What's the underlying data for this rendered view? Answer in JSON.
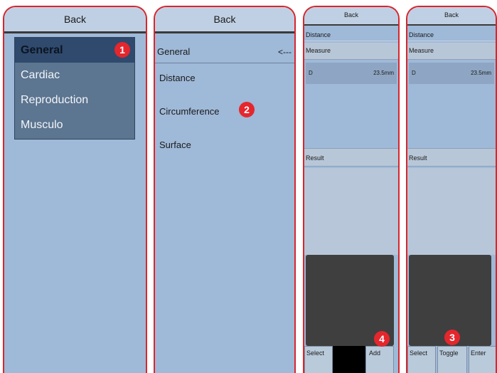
{
  "back_label": "Back",
  "panel1": {
    "menu": [
      {
        "label": "General",
        "active": true
      },
      {
        "label": "Cardiac",
        "active": false
      },
      {
        "label": "Reproduction",
        "active": false
      },
      {
        "label": "Musculo",
        "active": false
      }
    ]
  },
  "panel2": {
    "header": "General",
    "arrow": "<---",
    "items": [
      "Distance",
      "Circumference",
      "Surface"
    ]
  },
  "panel3": {
    "distance": "Distance",
    "measure": "Measure",
    "d_label": "D",
    "d_value": "23.5mm",
    "result": "Result",
    "buttons": {
      "select": "Select",
      "add": "Add"
    }
  },
  "panel4": {
    "distance": "Distance",
    "measure": "Measure",
    "d_label": "D",
    "d_value": "23.5mm",
    "result": "Result",
    "buttons": {
      "select": "Select",
      "toggle": "Toggle",
      "enter": "Enter"
    }
  },
  "markers": [
    "1",
    "2",
    "3",
    "4"
  ],
  "colors": {
    "accent": "#e5262d",
    "panel_bg": "#9fb9d8",
    "menu_bg": "#5c7590",
    "active_bg": "#2f4a6d"
  }
}
